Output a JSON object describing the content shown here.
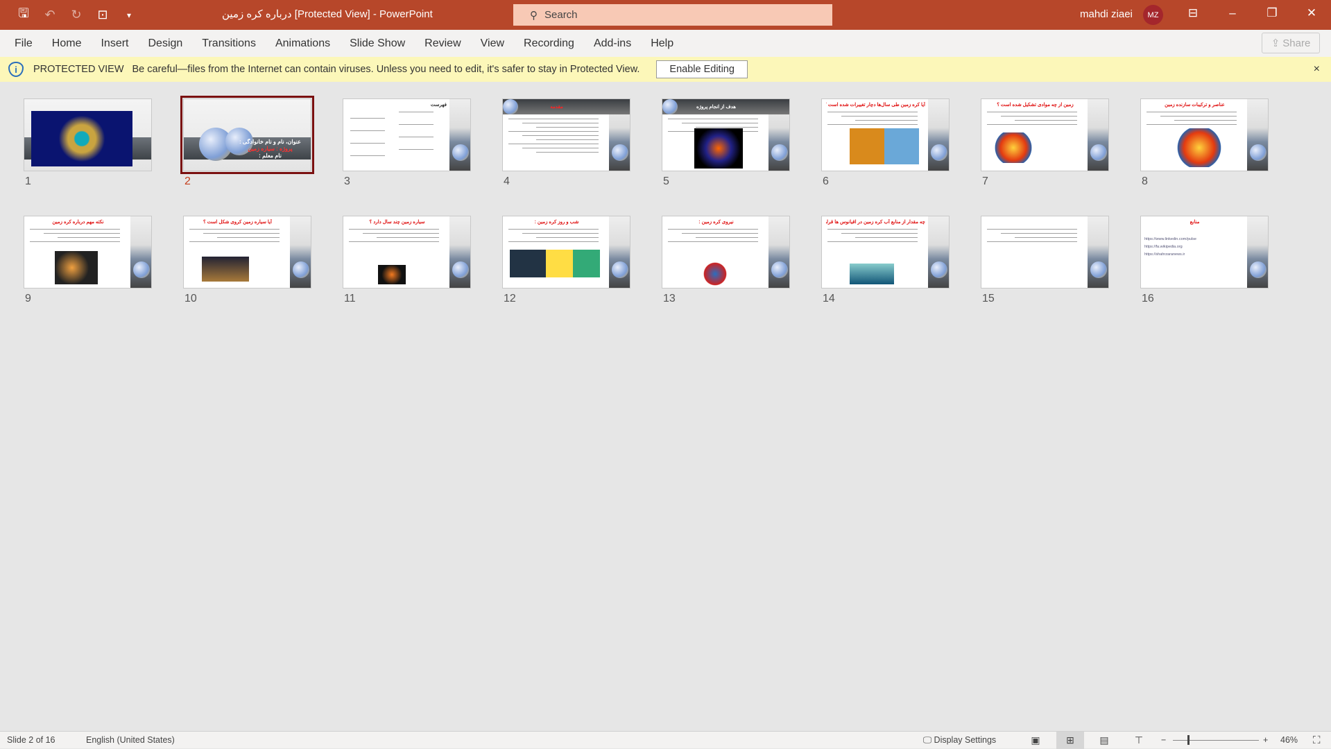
{
  "titlebar": {
    "title": "درباره کره زمین  [Protected View]  -  PowerPoint",
    "search_placeholder": "Search",
    "user": "mahdi ziaei",
    "initials": "MZ",
    "accent": "#b7472a"
  },
  "ribbon": {
    "tabs": [
      "File",
      "Home",
      "Insert",
      "Design",
      "Transitions",
      "Animations",
      "Slide Show",
      "Review",
      "View",
      "Recording",
      "Add-ins",
      "Help"
    ],
    "share": "Share"
  },
  "protected": {
    "label": "PROTECTED VIEW",
    "message": "Be careful—files from the Internet can contain viruses. Unless you need to edit, it's safer to stay in Protected View.",
    "button": "Enable Editing",
    "close": "×"
  },
  "selected_slide": 2,
  "slides": [
    {
      "n": "1",
      "title": ""
    },
    {
      "n": "2",
      "title": "",
      "lines": [
        "عنوان، نام و نام خانوادگی :",
        "پروژه : سیاره زمین",
        "نام معلم :"
      ]
    },
    {
      "n": "3",
      "title": "فهرست"
    },
    {
      "n": "4",
      "title": "مقدمه"
    },
    {
      "n": "5",
      "title": "هدف از انجام پروژه"
    },
    {
      "n": "6",
      "title": "آیا کره زمین طی سال‌ها دچار تغییرات شده است ؟"
    },
    {
      "n": "7",
      "title": "زمین از چه موادی تشکیل شده است ؟"
    },
    {
      "n": "8",
      "title": "عناصر و ترکیبات سازنده زمین"
    },
    {
      "n": "9",
      "title": "نکته مهم درباره کره زمین"
    },
    {
      "n": "10",
      "title": "آیا سیاره زمین کروی شکل است ؟"
    },
    {
      "n": "11",
      "title": "سیاره زمین چند سال دارد ؟"
    },
    {
      "n": "12",
      "title": "شب و روز کره زمین :"
    },
    {
      "n": "13",
      "title": "نیروی کره زمین :"
    },
    {
      "n": "14",
      "title": "چه مقدار از منابع آب کره زمین در اقیانوس ها قرار دارند؟"
    },
    {
      "n": "15",
      "title": ""
    },
    {
      "n": "16",
      "title": "منابع",
      "links": [
        "https://www.linkedin.com/pulse",
        "https://fa.wikipedia.org",
        "https://shahrzaranews.ir"
      ]
    }
  ],
  "status": {
    "slide": "Slide 2 of 16",
    "language": "English (United States)",
    "display_settings": "Display Settings",
    "zoom": "46%"
  }
}
